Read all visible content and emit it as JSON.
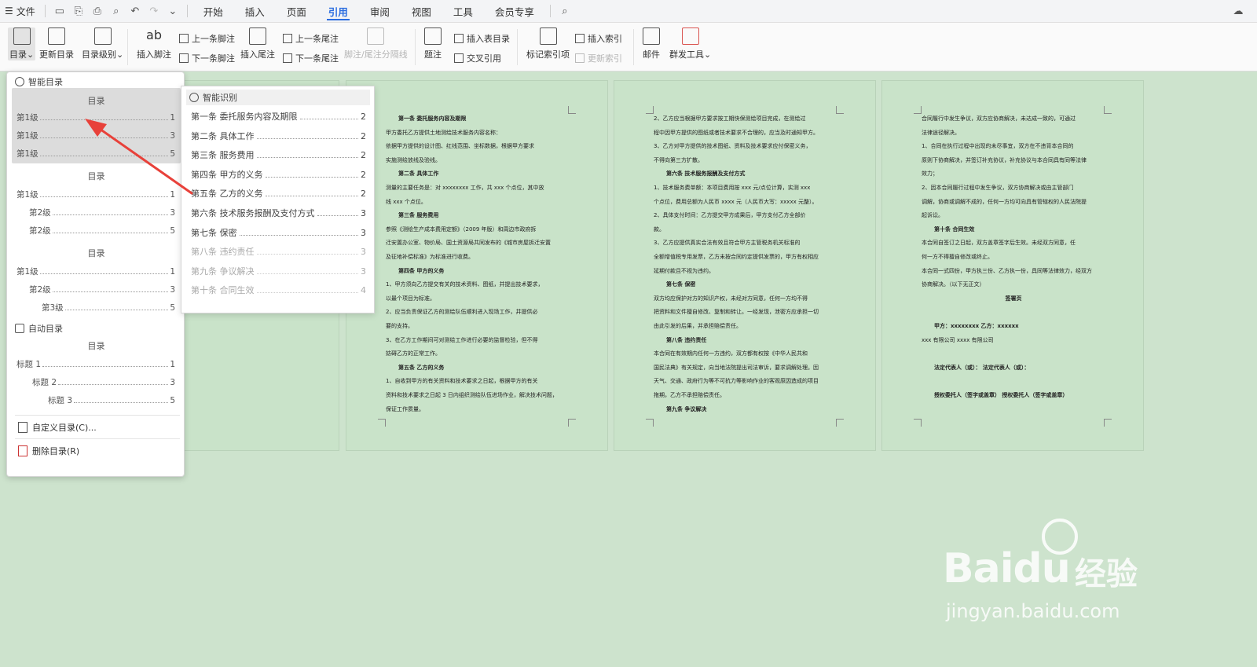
{
  "menubar": {
    "file_label": "文件",
    "tabs": [
      "开始",
      "插入",
      "页面",
      "引用",
      "审阅",
      "视图",
      "工具",
      "会员专享"
    ],
    "active_tab": "引用"
  },
  "ribbon": {
    "toc": "目录",
    "update_toc": "更新目录",
    "toc_level": "目录级别",
    "insert_footnote": "插入脚注",
    "prev_footnote": "上一条脚注",
    "next_footnote": "下一条脚注",
    "insert_endnote": "插入尾注",
    "prev_endnote": "上一条尾注",
    "next_endnote": "下一条尾注",
    "separator_line": "脚注/尾注分隔线",
    "caption": "题注",
    "insert_table_toc": "插入表目录",
    "cross_reference": "交叉引用",
    "mark_index": "标记索引项",
    "insert_index": "插入索引",
    "update_index": "更新索引",
    "mail": "邮件",
    "mail_merge": "群发工具"
  },
  "dropdown": {
    "smart_toc_header": "智能目录",
    "block1": {
      "title": "目录",
      "lines": [
        [
          "第1级",
          "1"
        ],
        [
          "第1级",
          "3"
        ],
        [
          "第1级",
          "5"
        ]
      ]
    },
    "block2": {
      "title": "目录",
      "lines": [
        [
          "第1级",
          "1"
        ],
        [
          "第2级",
          "3"
        ],
        [
          "第2级",
          "5"
        ]
      ]
    },
    "block3": {
      "title": "目录",
      "lines": [
        [
          "第1级",
          "1"
        ],
        [
          "第2级",
          "3"
        ],
        [
          "第3级",
          "5"
        ]
      ]
    },
    "auto_toc_header": "自动目录",
    "block4": {
      "title": "目录",
      "lines": [
        [
          "标题 1",
          "1"
        ],
        [
          "标题 2",
          "3"
        ],
        [
          "标题 3",
          "5"
        ]
      ]
    },
    "custom_toc": "自定义目录(C)...",
    "delete_toc": "删除目录(R)"
  },
  "submenu": {
    "header": "智能识别",
    "items": [
      [
        "第一条 委托服务内容及期限",
        "2"
      ],
      [
        "第二条 具体工作",
        "2"
      ],
      [
        "第三条 服务费用",
        "2"
      ],
      [
        "第四条 甲方的义务",
        "2"
      ],
      [
        "第五条 乙方的义务",
        "2"
      ],
      [
        "第六条 技术服务报酬及支付方式",
        "3"
      ],
      [
        "第七条 保密",
        "3"
      ],
      [
        "第八条 违约责任",
        "3"
      ],
      [
        "第九条 争议解决",
        "3"
      ],
      [
        "第十条 合同生效",
        "4"
      ]
    ]
  },
  "pages": {
    "page2": [
      [
        "b",
        "第一条  委托服务内容及期限"
      ],
      [
        "",
        "甲方委托乙方提供土地测绘技术服务内容名称："
      ],
      [
        "",
        "依据甲方提供的设计图、红线范围、坐标数据，根据甲方要求"
      ],
      [
        "",
        "实施测绘放线及验线。"
      ],
      [
        "b",
        "第二条  具体工作"
      ],
      [
        "",
        "测量的主要任务是：对 xxxxxxxx 工作，共 xxx 个点位，其中放"
      ],
      [
        "",
        "线 xxx 个点位。"
      ],
      [
        "b",
        "第三条  服务费用"
      ],
      [
        "",
        "参照《测绘生产成本费用定额》（2009 年版）和周边市政府拆"
      ],
      [
        "",
        "迁安置办公室、物价局、国土资源局共同发布的《城市房屋拆迁安置"
      ],
      [
        "",
        "及征地补偿标准》为标准进行收费。"
      ],
      [
        "b",
        "第四条  甲方的义务"
      ],
      [
        "",
        "1、甲方须向乙方提交有关的技术资料、图纸，并提出技术要求，"
      ],
      [
        "",
        "以最个项目为标准。"
      ],
      [
        "",
        "2、应当负责保证乙方的测绘队伍顺利进入现场工作，并提供必"
      ],
      [
        "",
        "要的支持。"
      ],
      [
        "",
        "3、在乙方工作期间可对测绘工作进行必要的监督检验，但不得"
      ],
      [
        "",
        "妨碍乙方的正常工作。"
      ],
      [
        "b",
        "第五条  乙方的义务"
      ],
      [
        "",
        "1、自收到甲方的有关资料和技术要求之日起，根据甲方的有关"
      ],
      [
        "",
        "资料和技术要求之日起 3 日内组织测绘队伍进场作业，解决技术问题，"
      ],
      [
        "",
        "保证工作质量。"
      ]
    ],
    "page3": [
      [
        "",
        "2、乙方应当根据甲方要求按工期快保测绘项目完成，在测绘过"
      ],
      [
        "",
        "程中因甲方提供的图纸或者技术要求不合理的，应当及时通知甲方。"
      ],
      [
        "",
        "3、乙方对甲方提供的技术图纸、资料及技术要求应付保密义务，"
      ],
      [
        "",
        "不得向第三方扩散。"
      ],
      [
        "b",
        "第六条  技术服务报酬及支付方式"
      ],
      [
        "",
        "1、技术服务费单额：本项目费用按 xxx 元/点位计算，实测 xxx"
      ],
      [
        "",
        "个点位，费用总额为人民币 xxxx 元（人民币大写：xxxxx 元整）。"
      ],
      [
        "",
        "2、具体支付时间：乙方提交甲方成果后，甲方支付乙方全部价"
      ],
      [
        "",
        "款。"
      ],
      [
        "",
        "3、乙方应提供真实合法有效且符合甲方主管税务机关标准的"
      ],
      [
        "",
        "全额增值税专用发票，乙方未按合同约定提供发票的，甲方有权相应"
      ],
      [
        "",
        "延期付款且不视为违约。"
      ],
      [
        "b",
        "第七条  保密"
      ],
      [
        "",
        "双方均应保护对方的知识产权，未经对方同意，任何一方均不得"
      ],
      [
        "",
        "把资料和文件擅自修改、复制和转让。一经发现，泄密方应承担一切"
      ],
      [
        "",
        "由此引发的后果，并承担赔偿责任。"
      ],
      [
        "b",
        "第八条  违约责任"
      ],
      [
        "",
        "本合同在有效期内任何一方违约，双方都有权按《中华人民共和"
      ],
      [
        "",
        "国民法典》有关规定，向当地法院提出司法审诉，要求调解处理。因"
      ],
      [
        "",
        "天气、交通、政府行为等不可抗力等影响作业的客观原因造成的项目"
      ],
      [
        "",
        "拖期，乙方不承担赔偿责任。"
      ],
      [
        "b",
        "第九条  争议解决"
      ]
    ],
    "page4": [
      [
        "",
        "合同履行中发生争议，双方应协商解决，未达成一致的，可通过"
      ],
      [
        "",
        "法律途径解决。"
      ],
      [
        "",
        "1、合同在执行过程中出现的未尽事宜，双方在不违背本合同的"
      ],
      [
        "",
        "原则下协商解决，并签订补充协议，补充协议与本合同具有同等法律"
      ],
      [
        "",
        "效力；"
      ],
      [
        "",
        "2、因本合同履行过程中发生争议，双方协商解决或由主管部门"
      ],
      [
        "",
        "调解，协商或调解不成的，任何一方均可向具有管辖权的人民法院提"
      ],
      [
        "",
        "起诉讼。"
      ],
      [
        "b",
        "第十条  合同生效"
      ],
      [
        "",
        "本合同自签订之日起，双方盖章签字后生效。未经双方同意，任"
      ],
      [
        "",
        "何一方不得擅自修改或终止。"
      ],
      [
        "",
        "本合同一式四份，甲方执三份、乙方执一份，具同等法律效力，经双方"
      ],
      [
        "",
        "协商解决。（以下无正文）"
      ],
      [
        "bc",
        "签署页"
      ],
      [
        "",
        " "
      ],
      [
        "b",
        "甲方：xxxxxxxx                    乙方：xxxxxx"
      ],
      [
        "",
        "      xxx 有限公司                          xxxx 有限公司"
      ],
      [
        "",
        " "
      ],
      [
        "b",
        "法定代表人（或）：                  法定代表人（或）："
      ],
      [
        "",
        " "
      ],
      [
        "b",
        "授权委托人（签字或盖章）        授权委托人（签字或盖章）"
      ]
    ]
  },
  "watermark": {
    "brand": "Baidu",
    "suffix": "经验",
    "url": "jingyan.baidu.com"
  },
  "colors": {
    "accent": "#2b6de0",
    "page_bg": "#cde3cd",
    "arrow": "#e8413a"
  }
}
